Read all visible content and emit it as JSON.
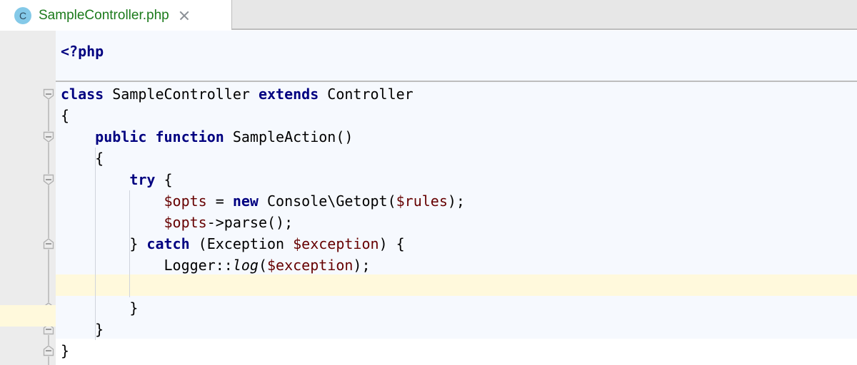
{
  "window": {
    "type": "code-editor",
    "language": "php"
  },
  "colors": {
    "editor_background": "#f6f9fe",
    "gutter_background": "#ececec",
    "tabbar_background": "#e7e7e7",
    "active_tab_background": "#ffffff",
    "tab_label_color": "#1b7a1b",
    "tab_icon_background": "#84c9e8",
    "caret_line_highlight": "#fff9dc",
    "keyword_color": "#000080",
    "variable_color": "#660000",
    "plain_text_color": "#000000",
    "separator_color": "#bdbdbd",
    "fold_marker_color": "#9a9a9a",
    "indent_guide_color": "#cfd4dc"
  },
  "tabbar": {
    "tabs": [
      {
        "icon": "php-class-icon",
        "icon_letter": "C",
        "label": "SampleController.php",
        "active": true,
        "close_icon": "close-icon"
      }
    ]
  },
  "editor": {
    "caret_line": 12,
    "fold_markers": [
      {
        "type": "collapse-down-icon",
        "line": 3
      },
      {
        "type": "collapse-down-icon",
        "line": 5
      },
      {
        "type": "collapse-down-icon",
        "line": 7
      },
      {
        "type": "collapse-up-icon",
        "line": 10
      },
      {
        "type": "collapse-up-icon",
        "line": 13
      },
      {
        "type": "collapse-up-icon",
        "line": 14
      },
      {
        "type": "collapse-up-icon",
        "line": 15
      }
    ],
    "lines": [
      {
        "n": 1,
        "indent": 0,
        "tokens": [
          {
            "t": "<?php",
            "c": "kw"
          }
        ]
      },
      {
        "n": 2,
        "indent": 0,
        "tokens": []
      },
      {
        "n": 3,
        "indent": 0,
        "tokens": [
          {
            "t": "class",
            "c": "kw"
          },
          {
            "t": " SampleController ",
            "c": "plain"
          },
          {
            "t": "extends",
            "c": "kw"
          },
          {
            "t": " Controller",
            "c": "plain"
          }
        ]
      },
      {
        "n": 4,
        "indent": 0,
        "tokens": [
          {
            "t": "{",
            "c": "plain"
          }
        ]
      },
      {
        "n": 5,
        "indent": 1,
        "tokens": [
          {
            "t": "public",
            "c": "kw"
          },
          {
            "t": " ",
            "c": "plain"
          },
          {
            "t": "function",
            "c": "kw"
          },
          {
            "t": " SampleAction()",
            "c": "plain"
          }
        ]
      },
      {
        "n": 6,
        "indent": 1,
        "tokens": [
          {
            "t": "{",
            "c": "plain"
          }
        ]
      },
      {
        "n": 7,
        "indent": 2,
        "tokens": [
          {
            "t": "try",
            "c": "kw"
          },
          {
            "t": " {",
            "c": "plain"
          }
        ]
      },
      {
        "n": 8,
        "indent": 3,
        "tokens": [
          {
            "t": "$opts",
            "c": "var"
          },
          {
            "t": " = ",
            "c": "plain"
          },
          {
            "t": "new",
            "c": "kw"
          },
          {
            "t": " Console\\Getopt(",
            "c": "plain"
          },
          {
            "t": "$rules",
            "c": "var"
          },
          {
            "t": ");",
            "c": "plain"
          }
        ]
      },
      {
        "n": 9,
        "indent": 3,
        "tokens": [
          {
            "t": "$opts",
            "c": "var"
          },
          {
            "t": "->parse();",
            "c": "plain"
          }
        ]
      },
      {
        "n": 10,
        "indent": 2,
        "tokens": [
          {
            "t": "} ",
            "c": "plain"
          },
          {
            "t": "catch",
            "c": "kw"
          },
          {
            "t": " (Exception ",
            "c": "plain"
          },
          {
            "t": "$exception",
            "c": "var"
          },
          {
            "t": ") {",
            "c": "plain"
          }
        ]
      },
      {
        "n": 11,
        "indent": 3,
        "tokens": [
          {
            "t": "Logger::",
            "c": "plain"
          },
          {
            "t": "log",
            "c": "ital"
          },
          {
            "t": "(",
            "c": "plain"
          },
          {
            "t": "$exception",
            "c": "var"
          },
          {
            "t": ");",
            "c": "plain"
          }
        ]
      },
      {
        "n": 12,
        "indent": 3,
        "tokens": []
      },
      {
        "n": 13,
        "indent": 2,
        "tokens": [
          {
            "t": "}",
            "c": "plain"
          }
        ]
      },
      {
        "n": 14,
        "indent": 1,
        "tokens": [
          {
            "t": "}",
            "c": "plain"
          }
        ]
      },
      {
        "n": 15,
        "indent": 0,
        "tokens": [
          {
            "t": "}",
            "c": "plain"
          }
        ]
      }
    ]
  }
}
